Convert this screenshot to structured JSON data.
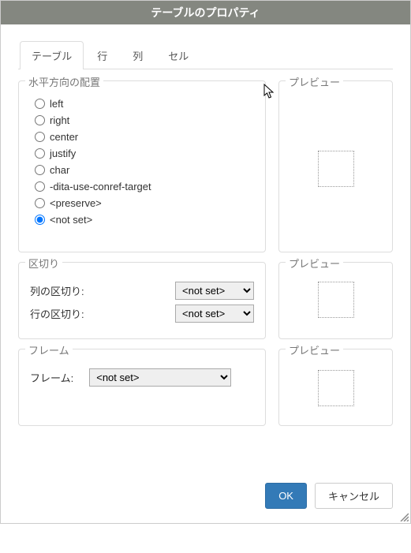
{
  "title": "テーブルのプロパティ",
  "tabs": [
    "テーブル",
    "行",
    "列",
    "セル"
  ],
  "active_tab": 0,
  "sections": {
    "align": {
      "legend": "水平方向の配置",
      "options": [
        "left",
        "right",
        "center",
        "justify",
        "char",
        "-dita-use-conref-target",
        "<preserve>",
        "<not set>"
      ],
      "selected": "<not set>"
    },
    "separators": {
      "legend": "区切り",
      "col_label": "列の区切り:",
      "row_label": "行の区切り:",
      "col_value": "<not set>",
      "row_value": "<not set>"
    },
    "frame": {
      "legend": "フレーム",
      "label": "フレーム:",
      "value": "<not set>"
    }
  },
  "preview_label": "プレビュー",
  "buttons": {
    "ok": "OK",
    "cancel": "キャンセル"
  },
  "select_options": {
    "not_set": "<not set>"
  }
}
